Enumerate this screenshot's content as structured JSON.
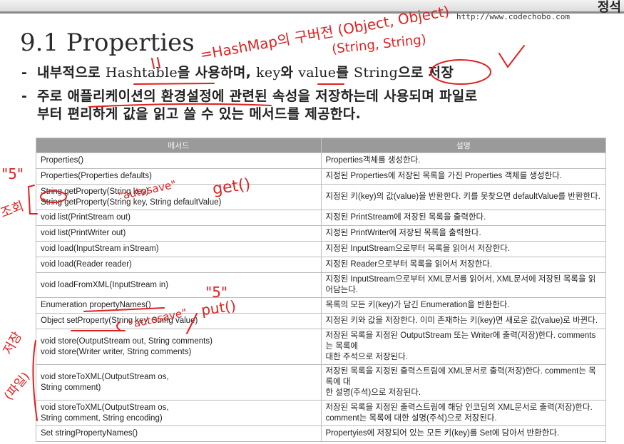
{
  "header": {
    "corner_text": "정석",
    "url": "http://www.codechobo.com"
  },
  "title": "9.1 Properties",
  "bullets": [
    {
      "dash": "-",
      "pre": "내부적으로 ",
      "hashtable": "Hashtable",
      "mid1": "을 사용하며, ",
      "key": "key",
      "mid2": "와 ",
      "value": "value",
      "mid3": "를 ",
      "string": "String",
      "post": "으로 저장"
    },
    {
      "dash": "-",
      "line1": "주로 애플리케이션의 환경설정에 관련된 속성을 저장하는데 사용되며 파일로",
      "line2": "부터 편리하게 값을 읽고 쓸 수 있는 메서드를 제공한다."
    }
  ],
  "table": {
    "headers": [
      "메서드",
      "설명"
    ],
    "rows": [
      {
        "method": [
          "Properties()"
        ],
        "desc": [
          "Properties객체를 생성한다."
        ]
      },
      {
        "method": [
          "Properties(Properties defaults)"
        ],
        "desc": [
          "지정된 Properties에 저장된 목록을 가진 Properties 객체를 생성한다."
        ]
      },
      {
        "method": [
          "String getProperty(String key)",
          "String getProperty(String key, String defaultValue)"
        ],
        "desc": [
          "지정된 키(key)의 값(value)을 반환한다. 키를 못찾으면 defaultValue를 반환한다."
        ]
      },
      {
        "method": [
          "void list(PrintStream out)"
        ],
        "desc": [
          "지정된 PrintStream에 저장된 목록을 출력한다."
        ]
      },
      {
        "method": [
          "void list(PrintWriter out)"
        ],
        "desc": [
          "지정된 PrintWriter에 저장된 목록을 출력한다."
        ]
      },
      {
        "method": [
          "void load(InputStream inStream)"
        ],
        "desc": [
          "지정된 InputStream으로부터 목록을 읽어서 저장한다."
        ]
      },
      {
        "method": [
          "void load(Reader reader)"
        ],
        "desc": [
          "지정된 Reader으로부터 목록을 읽어서 저장한다."
        ]
      },
      {
        "method": [
          "void loadFromXML(InputStream in)"
        ],
        "desc": [
          "지정된 InputStream으로부터 XML문서를 읽어서, XML문서에 저장된 목록을 읽어담는다."
        ]
      },
      {
        "method": [
          "Enumeration propertyNames()"
        ],
        "desc": [
          "목록의 모든 키(key)가 담긴 Enumeration을 반환한다."
        ]
      },
      {
        "method": [
          "Object setProperty(String key, String value)"
        ],
        "desc": [
          "지정된 키와 값을 저장한다. 이미 존재하는 키(key)면 새로운 값(value)로 바뀐다."
        ]
      },
      {
        "method": [
          "void store(OutputStream out, String comments)",
          "void store(Writer writer, String comments)"
        ],
        "desc": [
          "저장된 목록을 지정된 OutputStream 또는 Writer에 출력(저장)한다. comments는 목록에",
          "대한 주석으로 저장된다."
        ]
      },
      {
        "method": [
          "void storeToXML(OutputStream os,",
          "String comment)"
        ],
        "desc": [
          "저장된 목록을 지정된 출력스트림에 XML문서로 출력(저장)한다. comment는 목록에 대",
          "한 설명(주석)으로 저장된다."
        ]
      },
      {
        "method": [
          "void storeToXML(OutputStream os,",
          "String comment, String encoding)"
        ],
        "desc": [
          "저장된 목록을 지정된 출력스트림에 해당 인코딩의 XML문서로 출력(저장)한다.",
          "comment는 목록에 대한 설명(주석)으로 저장된다."
        ]
      },
      {
        "method": [
          "Set stringPropertyNames()"
        ],
        "desc": [
          "Propertyies에 저장되어 있는 모든 키(key)를 Set에 담아서 반환한다."
        ]
      }
    ]
  },
  "handwriting": {
    "top": "=HashMap의 구버전 (Object, Object)",
    "string_pair": "(String, String)",
    "five_1": "\"5\"",
    "autosave_1": "\"autosave\"",
    "get": "get()",
    "side_1": "조회",
    "five_2": "\"5\"",
    "autosave_2": "\"autosave\"",
    "put": "put()",
    "side_2": "저장",
    "side_3": "(파일)"
  }
}
